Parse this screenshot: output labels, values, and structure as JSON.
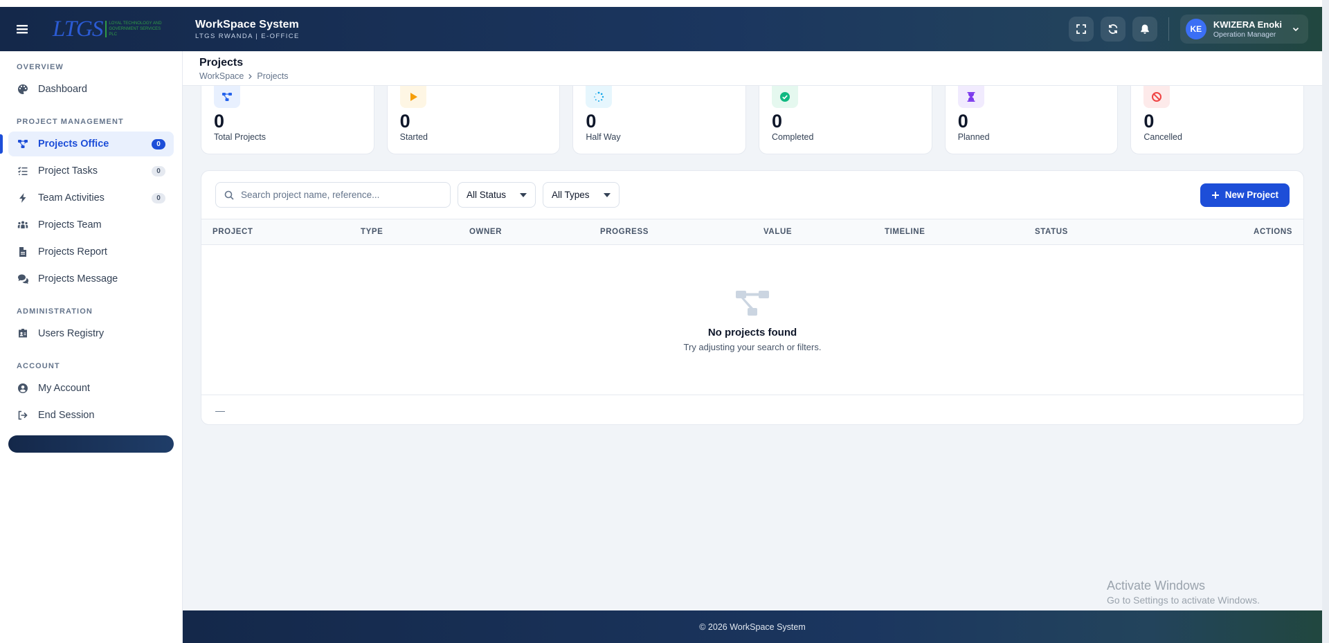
{
  "topbar": {
    "logo_text": "LTGS",
    "logo_tagline": "LOYAL TECHNOLOGY AND GOVERNMENT SERVICES PLC",
    "app_title": "WorkSpace System",
    "app_subtitle": "LTGS RWANDA | E-OFFICE",
    "user": {
      "initials": "KE",
      "name": "KWIZERA Enoki",
      "role": "Operation Manager"
    }
  },
  "sidebar": {
    "sections": {
      "overview": "OVERVIEW",
      "project_management": "PROJECT MANAGEMENT",
      "administration": "ADMINISTRATION",
      "account": "ACCOUNT"
    },
    "items": {
      "dashboard": {
        "label": "Dashboard",
        "icon": "palette-icon"
      },
      "projects_office": {
        "label": "Projects Office",
        "count": "0",
        "icon": "sitemap-icon"
      },
      "project_tasks": {
        "label": "Project Tasks",
        "count": "0",
        "icon": "list-check-icon"
      },
      "team_activities": {
        "label": "Team Activities",
        "count": "0",
        "icon": "bolt-icon"
      },
      "projects_team": {
        "label": "Projects Team",
        "icon": "people-group-icon"
      },
      "projects_report": {
        "label": "Projects Report",
        "icon": "file-icon"
      },
      "projects_message": {
        "label": "Projects Message",
        "icon": "comments-icon"
      },
      "users_registry": {
        "label": "Users Registry",
        "icon": "id-badge-icon"
      },
      "my_account": {
        "label": "My Account",
        "icon": "user-circle-icon"
      },
      "end_session": {
        "label": "End Session",
        "icon": "sign-out-icon"
      }
    }
  },
  "page": {
    "title": "Projects",
    "breadcrumb": [
      "WorkSpace",
      "Projects"
    ]
  },
  "stats": [
    {
      "value": "0",
      "label": "Total Projects",
      "icon": "sitemap-icon",
      "color": "#2563eb",
      "bg": "#e8f0fe"
    },
    {
      "value": "0",
      "label": "Started",
      "icon": "play-icon",
      "color": "#f59e0b",
      "bg": "#fef6e4"
    },
    {
      "value": "0",
      "label": "Half Way",
      "icon": "spinner-icon",
      "color": "#0ea5e9",
      "bg": "#e6f6fd"
    },
    {
      "value": "0",
      "label": "Completed",
      "icon": "check-circle-icon",
      "color": "#10b981",
      "bg": "#e5f8ef"
    },
    {
      "value": "0",
      "label": "Planned",
      "icon": "hourglass-icon",
      "color": "#7c3aed",
      "bg": "#f1ebfe"
    },
    {
      "value": "0",
      "label": "Cancelled",
      "icon": "ban-icon",
      "color": "#ef4444",
      "bg": "#fdeaea"
    }
  ],
  "toolbar": {
    "search_placeholder": "Search project name, reference...",
    "status_filter": "All Status",
    "type_filter": "All Types",
    "new_project": "New Project"
  },
  "table": {
    "columns": [
      "PROJECT",
      "TYPE",
      "OWNER",
      "PROGRESS",
      "VALUE",
      "TIMELINE",
      "STATUS",
      "ACTIONS"
    ],
    "rows": [],
    "empty_title": "No projects found",
    "empty_subtitle": "Try adjusting your search or filters.",
    "pagination": "—"
  },
  "watermark": {
    "title": "Activate Windows",
    "subtitle": "Go to Settings to activate Windows."
  },
  "footer": {
    "text": "© 2026 WorkSpace System"
  },
  "colors": {
    "accent": "#1d4ed8",
    "topbar": "#14284a",
    "background": "#f1f4f8"
  }
}
